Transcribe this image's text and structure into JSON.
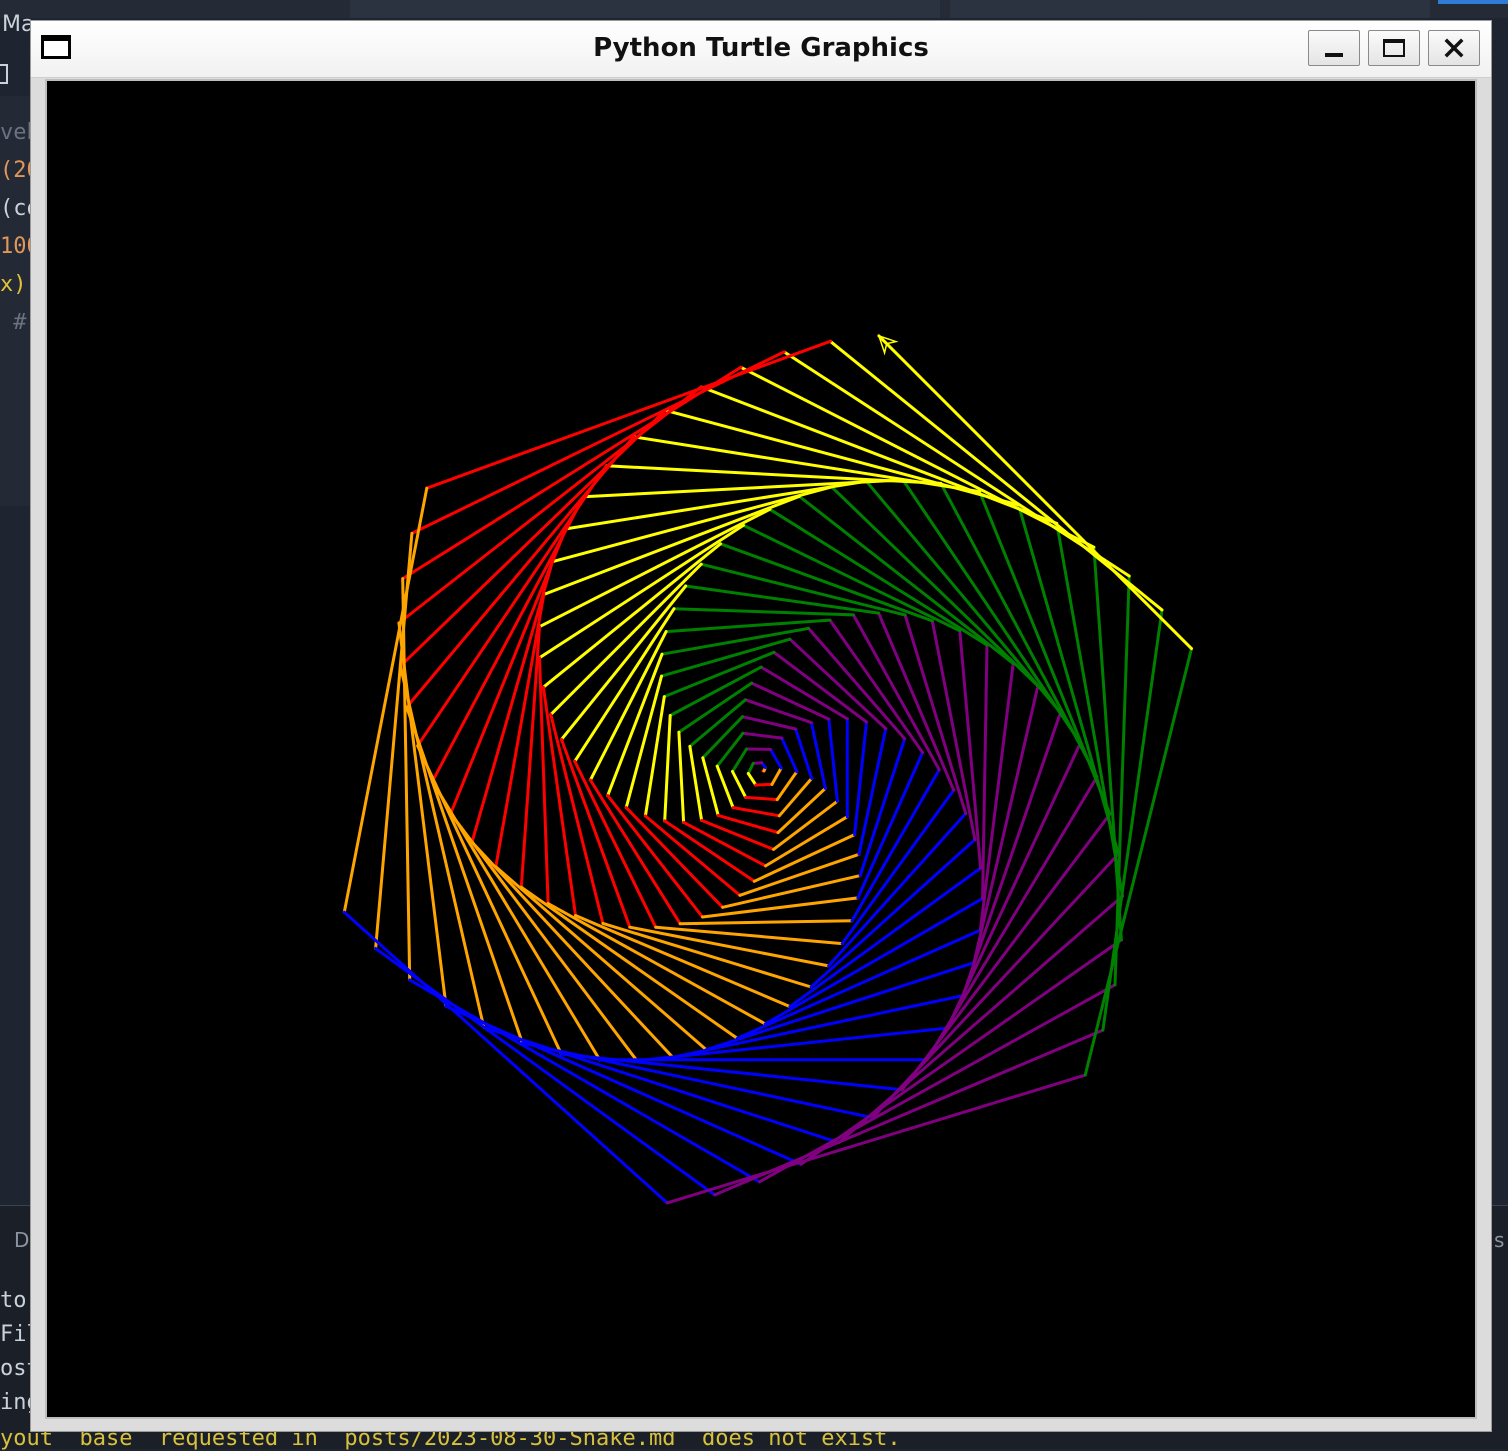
{
  "window": {
    "title": "Python Turtle Graphics",
    "buttons": {
      "minimize": "minimize",
      "maximize": "maximize",
      "close": "close"
    }
  },
  "background_editor": {
    "tab_text": "Ma",
    "code_lines": [
      {
        "text": "veb",
        "color": "#6b7280"
      },
      {
        "text": "(20",
        "color": "#e0975c"
      },
      {
        "text": "(co",
        "color": "#c9d1d9"
      },
      {
        "text": "100",
        "color": "#e0975c"
      },
      {
        "text": "x)",
        "color": "#e3c23b"
      },
      {
        "text": " #",
        "color": "#6b7280"
      }
    ],
    "panel_tab_left": "D",
    "panel_tab_right": "s",
    "terminal_lines": [
      "tor",
      "Fil",
      "ost",
      "ing"
    ],
    "terminal_warning": "yout `base` requested in `posts/2023-08-30-Snake.md` does not exist."
  },
  "drawing": {
    "background": "#000000",
    "colors": [
      "#ff0000",
      "#ffa500",
      "#0000ff",
      "#800080",
      "#008000",
      "#ffff00"
    ],
    "turtle_shape": "classic-arrow",
    "turtle_color": "#ffff00"
  }
}
